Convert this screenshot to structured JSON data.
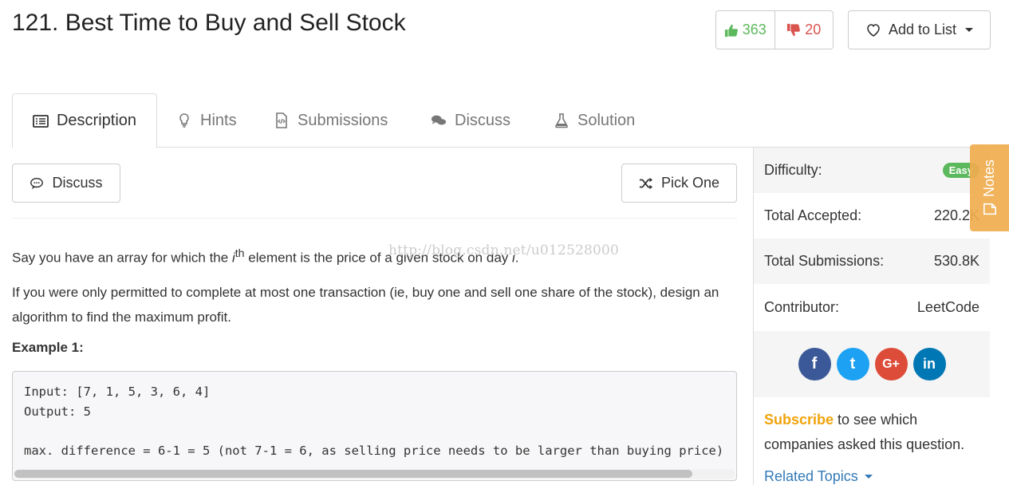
{
  "problem": {
    "title": "121. Best Time to Buy and Sell Stock"
  },
  "votes": {
    "up": "363",
    "down": "20"
  },
  "add_to_list": {
    "label": "Add to List"
  },
  "tabs": [
    {
      "label": "Description",
      "icon": "list-icon"
    },
    {
      "label": "Hints",
      "icon": "lightbulb-icon"
    },
    {
      "label": "Submissions",
      "icon": "code-file-icon"
    },
    {
      "label": "Discuss",
      "icon": "comments-icon"
    },
    {
      "label": "Solution",
      "icon": "flask-icon"
    }
  ],
  "actions": {
    "discuss": "Discuss",
    "pick_one": "Pick One"
  },
  "description": {
    "p1_a": "Say you have an array for which the ",
    "p1_i": "i",
    "p1_sup": "th",
    "p1_b": " element is the price of a given stock on day ",
    "p1_day": "i",
    "p1_end": ".",
    "p2": "If you were only permitted to complete at most one transaction (ie, buy one and sell one share of the stock), design an algorithm to find the maximum profit.",
    "watermark": "http://blog.csdn.net/u012528000"
  },
  "example": {
    "heading": "Example 1:",
    "code": "Input: [7, 1, 5, 3, 6, 4]\nOutput: 5\n\nmax. difference = 6-1 = 5 (not 7-1 = 6, as selling price needs to be larger than buying price)"
  },
  "sidebar": {
    "difficulty_label": "Difficulty:",
    "difficulty_value": "Easy",
    "accepted_label": "Total Accepted:",
    "accepted_value": "220.2K",
    "submissions_label": "Total Submissions:",
    "submissions_value": "530.8K",
    "contributor_label": "Contributor:",
    "contributor_value": "LeetCode",
    "subscribe_link": "Subscribe",
    "subscribe_text": " to see which companies asked this question.",
    "related_topics": "Related Topics"
  },
  "social": [
    {
      "name": "facebook",
      "glyph": "f",
      "color": "#3b5998"
    },
    {
      "name": "twitter",
      "glyph": "t",
      "color": "#1da1f2"
    },
    {
      "name": "google-plus",
      "glyph": "G+",
      "color": "#dd4b39"
    },
    {
      "name": "linkedin",
      "glyph": "in",
      "color": "#0077b5"
    }
  ],
  "notes": {
    "label": "Notes"
  },
  "colors": {
    "success": "#5cb85c",
    "danger": "#d9534f",
    "notes": "#f0ad4e",
    "link": "#337ab7",
    "subscribe": "#f0a30a"
  }
}
